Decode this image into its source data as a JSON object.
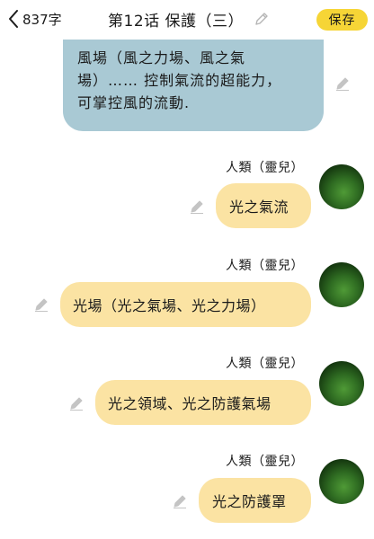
{
  "header": {
    "word_count": "837字",
    "title": "第12话 保護（三）",
    "save_label": "保存"
  },
  "messages": [
    {
      "lines": [
        "風場（風之力場、風之氣",
        "場）…… 控制氣流的超能力，",
        "可掌控風的流動."
      ]
    },
    {
      "sender": "人類（靈兒）",
      "text": "光之氣流"
    },
    {
      "sender": "人類（靈兒）",
      "text": "光場（光之氣場、光之力場）"
    },
    {
      "sender": "人類（靈兒）",
      "text": "光之領域、光之防護氣場"
    },
    {
      "sender": "人類（靈兒）",
      "text": "光之防護罩"
    }
  ],
  "colors": {
    "save_button": "#f6d536",
    "left_bubble": "#a9c9d4",
    "right_bubble": "#fbe3a3",
    "icon_gray": "#b5b5b5"
  },
  "icons": {
    "back": "chevron-left-icon",
    "edit": "pencil-icon"
  }
}
